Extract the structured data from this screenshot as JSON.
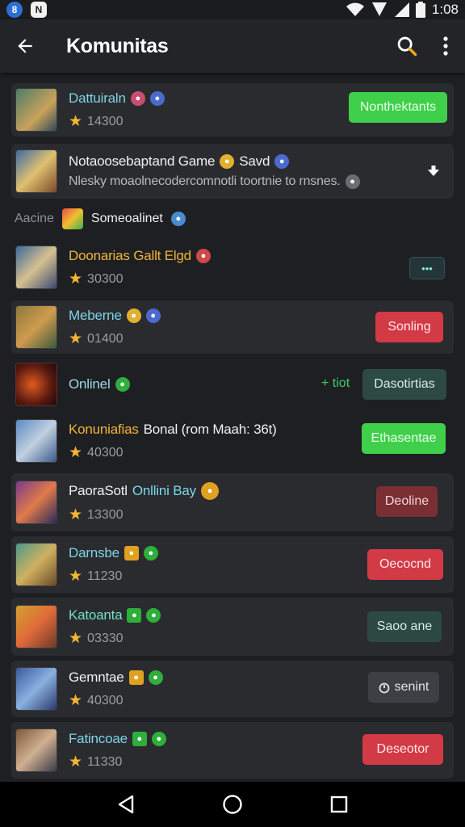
{
  "status_bar": {
    "time": "1:08"
  },
  "app_bar": {
    "title": "Komunitas",
    "icons": [
      "arrow-back-icon",
      "search-icon",
      "more-vert-icon"
    ]
  },
  "section": {
    "label": "Aacine",
    "text": "Someoalinet"
  },
  "items": [
    {
      "name": "Dattuiraln",
      "rating": "14300",
      "button": "Nonthektants",
      "button_color": "#3fcf4a"
    },
    {
      "name": "Notaoosebaptand Game",
      "name_suffix": "Savd",
      "subtitle": "Nlesky moaolnecodercomnotli toortnie to rnsnes.",
      "action_icon": "chevron-down-icon"
    },
    {
      "name": "Doonarias Gallt Elgd",
      "rating": "30300",
      "button": "•••"
    },
    {
      "name": "Meberne",
      "rating": "01400",
      "button": "Sonling",
      "button_color": "#d23a45"
    },
    {
      "name": "Onlinel",
      "plus_text": "+ tiot",
      "button": "Dasotirtias"
    },
    {
      "name": "Konuniafias",
      "name_rest": "Bonal (rom Maah: 36t)",
      "rating": "40300",
      "button": "Ethasentae",
      "button_color": "#3fcf4a"
    },
    {
      "name": "PaoraSotl",
      "name_rest": "Onllini Bay",
      "rating": "13300",
      "button": "Deoline"
    },
    {
      "name": "Darnsbe",
      "rating": "11230",
      "button": "Oecocnd",
      "button_color": "#d23a45"
    },
    {
      "name": "Katoanta",
      "rating": "03330",
      "button": "Saoo ane"
    },
    {
      "name": "Gemntae",
      "rating": "40300",
      "button": "senint"
    },
    {
      "name": "Fatincoae",
      "rating": "11330",
      "button": "Deseotor",
      "button_color": "#d23a45"
    }
  ],
  "nav_bar": {
    "icons": [
      "back-triangle-icon",
      "home-circle-icon",
      "recents-square-icon"
    ]
  }
}
